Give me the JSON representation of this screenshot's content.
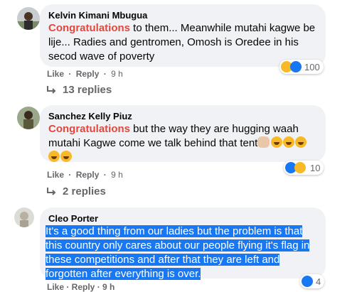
{
  "comments": [
    {
      "author": "Kelvin Kimani Mbugua",
      "highlight": "Congratulations",
      "text": " to them... Meanwhile mutahi kagwe be lije... Radies and gentromen, Omosh is Oredee in his secod wave of poverty",
      "like": "Like",
      "reply": "Reply",
      "time": "9 h",
      "reaction_count": "100",
      "replies": "13 replies"
    },
    {
      "author": "Sanchez Kelly Piuz",
      "highlight": "Congratulations",
      "text": " but the way they are hugging waah mutahi Kagwe come we talk behind that tent",
      "like": "Like",
      "reply": "Reply",
      "time": "9 h",
      "reaction_count": "10",
      "replies": "2 replies"
    },
    {
      "author": "Cleo Porter",
      "text_lines": [
        "It's a good thing from our ladies but the problem is that",
        "this country only cares about our people flying it's flag in",
        "these competitions and after that they are left and",
        "forgotten after everything is over."
      ],
      "reaction_count": "4",
      "partial_actions": "Like · Reply · 9 h"
    }
  ],
  "separator": "·",
  "colors": {
    "bubble": "#f0f2f5",
    "congrats": "#e4473b",
    "selection": "#1877f2",
    "meta": "#65676b"
  }
}
